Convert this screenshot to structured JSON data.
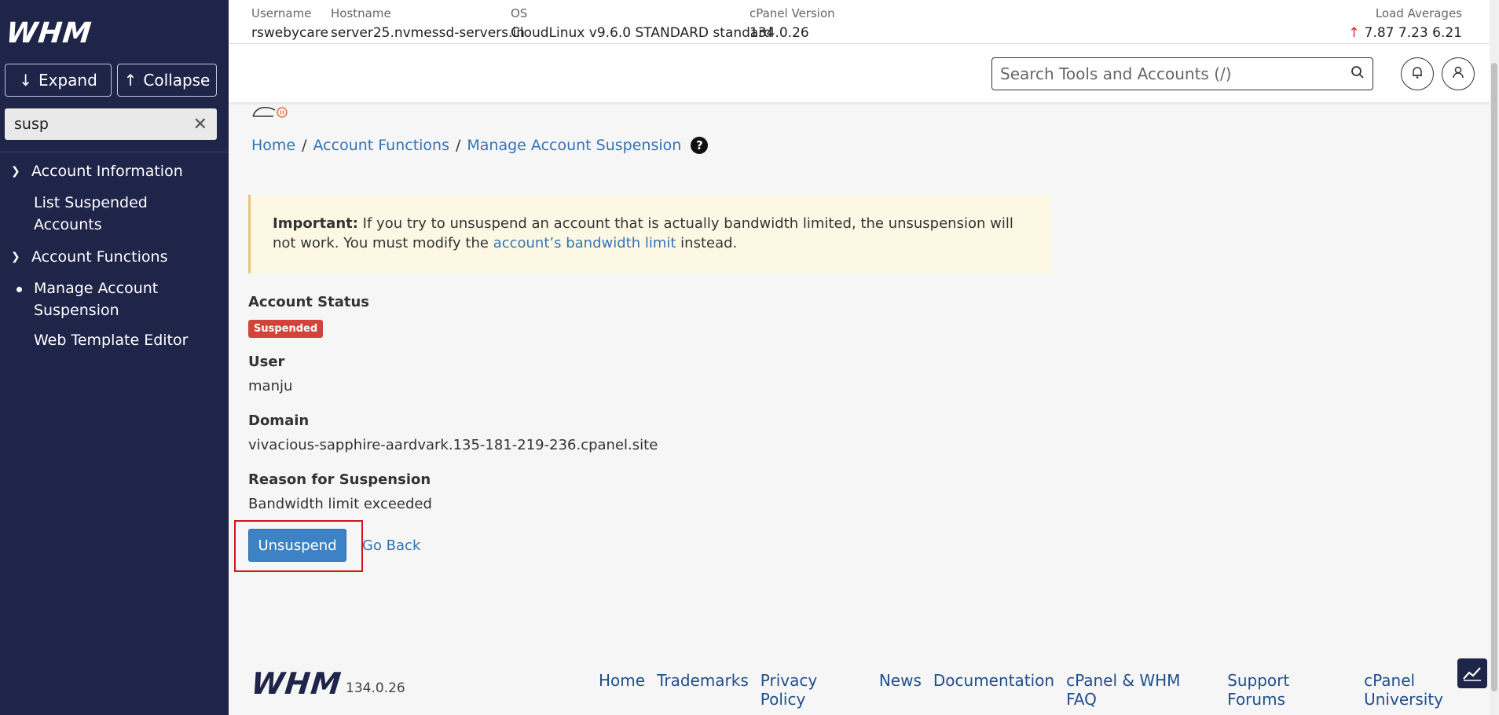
{
  "sidebar": {
    "logo": "WHM",
    "expand_label": "Expand",
    "collapse_label": "Collapse",
    "search_value": "susp",
    "categories": [
      {
        "label": "Account Information",
        "items": [
          "List Suspended",
          "Accounts"
        ]
      },
      {
        "label": "Account Functions",
        "items": [
          "Manage Account",
          "Suspension",
          "Web Template Editor"
        ]
      }
    ]
  },
  "header": {
    "username_label": "Username",
    "username": "rswebycare",
    "hostname_label": "Hostname",
    "hostname": "server25.nvmessd-servers.in",
    "os_label": "OS",
    "os": "CloudLinux v9.6.0 STANDARD standard",
    "cpanel_version_label": "cPanel Version",
    "cpanel_version": "134.0.26",
    "load_label": "Load Averages",
    "load_values": "7.87  7.23  6.21",
    "search_placeholder": "Search Tools and Accounts (/)"
  },
  "main": {
    "title": "Manage Account Suspension",
    "breadcrumb": [
      "Home",
      "Account Functions",
      "Manage Account Suspension"
    ],
    "alert": {
      "strong": "Important:",
      "text_before": " If you try to unsuspend an account that is actually bandwidth limited, the unsuspension will not work. You must modify the ",
      "link": "account’s bandwidth limit",
      "text_after": " instead."
    },
    "account_status_label": "Account Status",
    "account_status": "Suspended",
    "user_label": "User",
    "user": "manju",
    "domain_label": "Domain",
    "domain": "vivacious-sapphire-aardvark.135-181-219-236.cpanel.site",
    "reason_label": "Reason for Suspension",
    "reason": "Bandwidth limit exceeded",
    "unsuspend_label": "Unsuspend",
    "go_back_label": "Go Back"
  },
  "footer": {
    "logo": "WHM",
    "version": "134.0.26",
    "links": [
      "Home",
      "Trademarks",
      "Privacy Policy",
      "News",
      "Documentation",
      "cPanel & WHM FAQ",
      "Support Forums",
      "cPanel University"
    ]
  },
  "colors": {
    "sidebar_bg": "#1f2449",
    "link": "#3173b5",
    "primary_button": "#3d82c4",
    "badge": "#d0443b",
    "highlight": "#d0151c"
  }
}
